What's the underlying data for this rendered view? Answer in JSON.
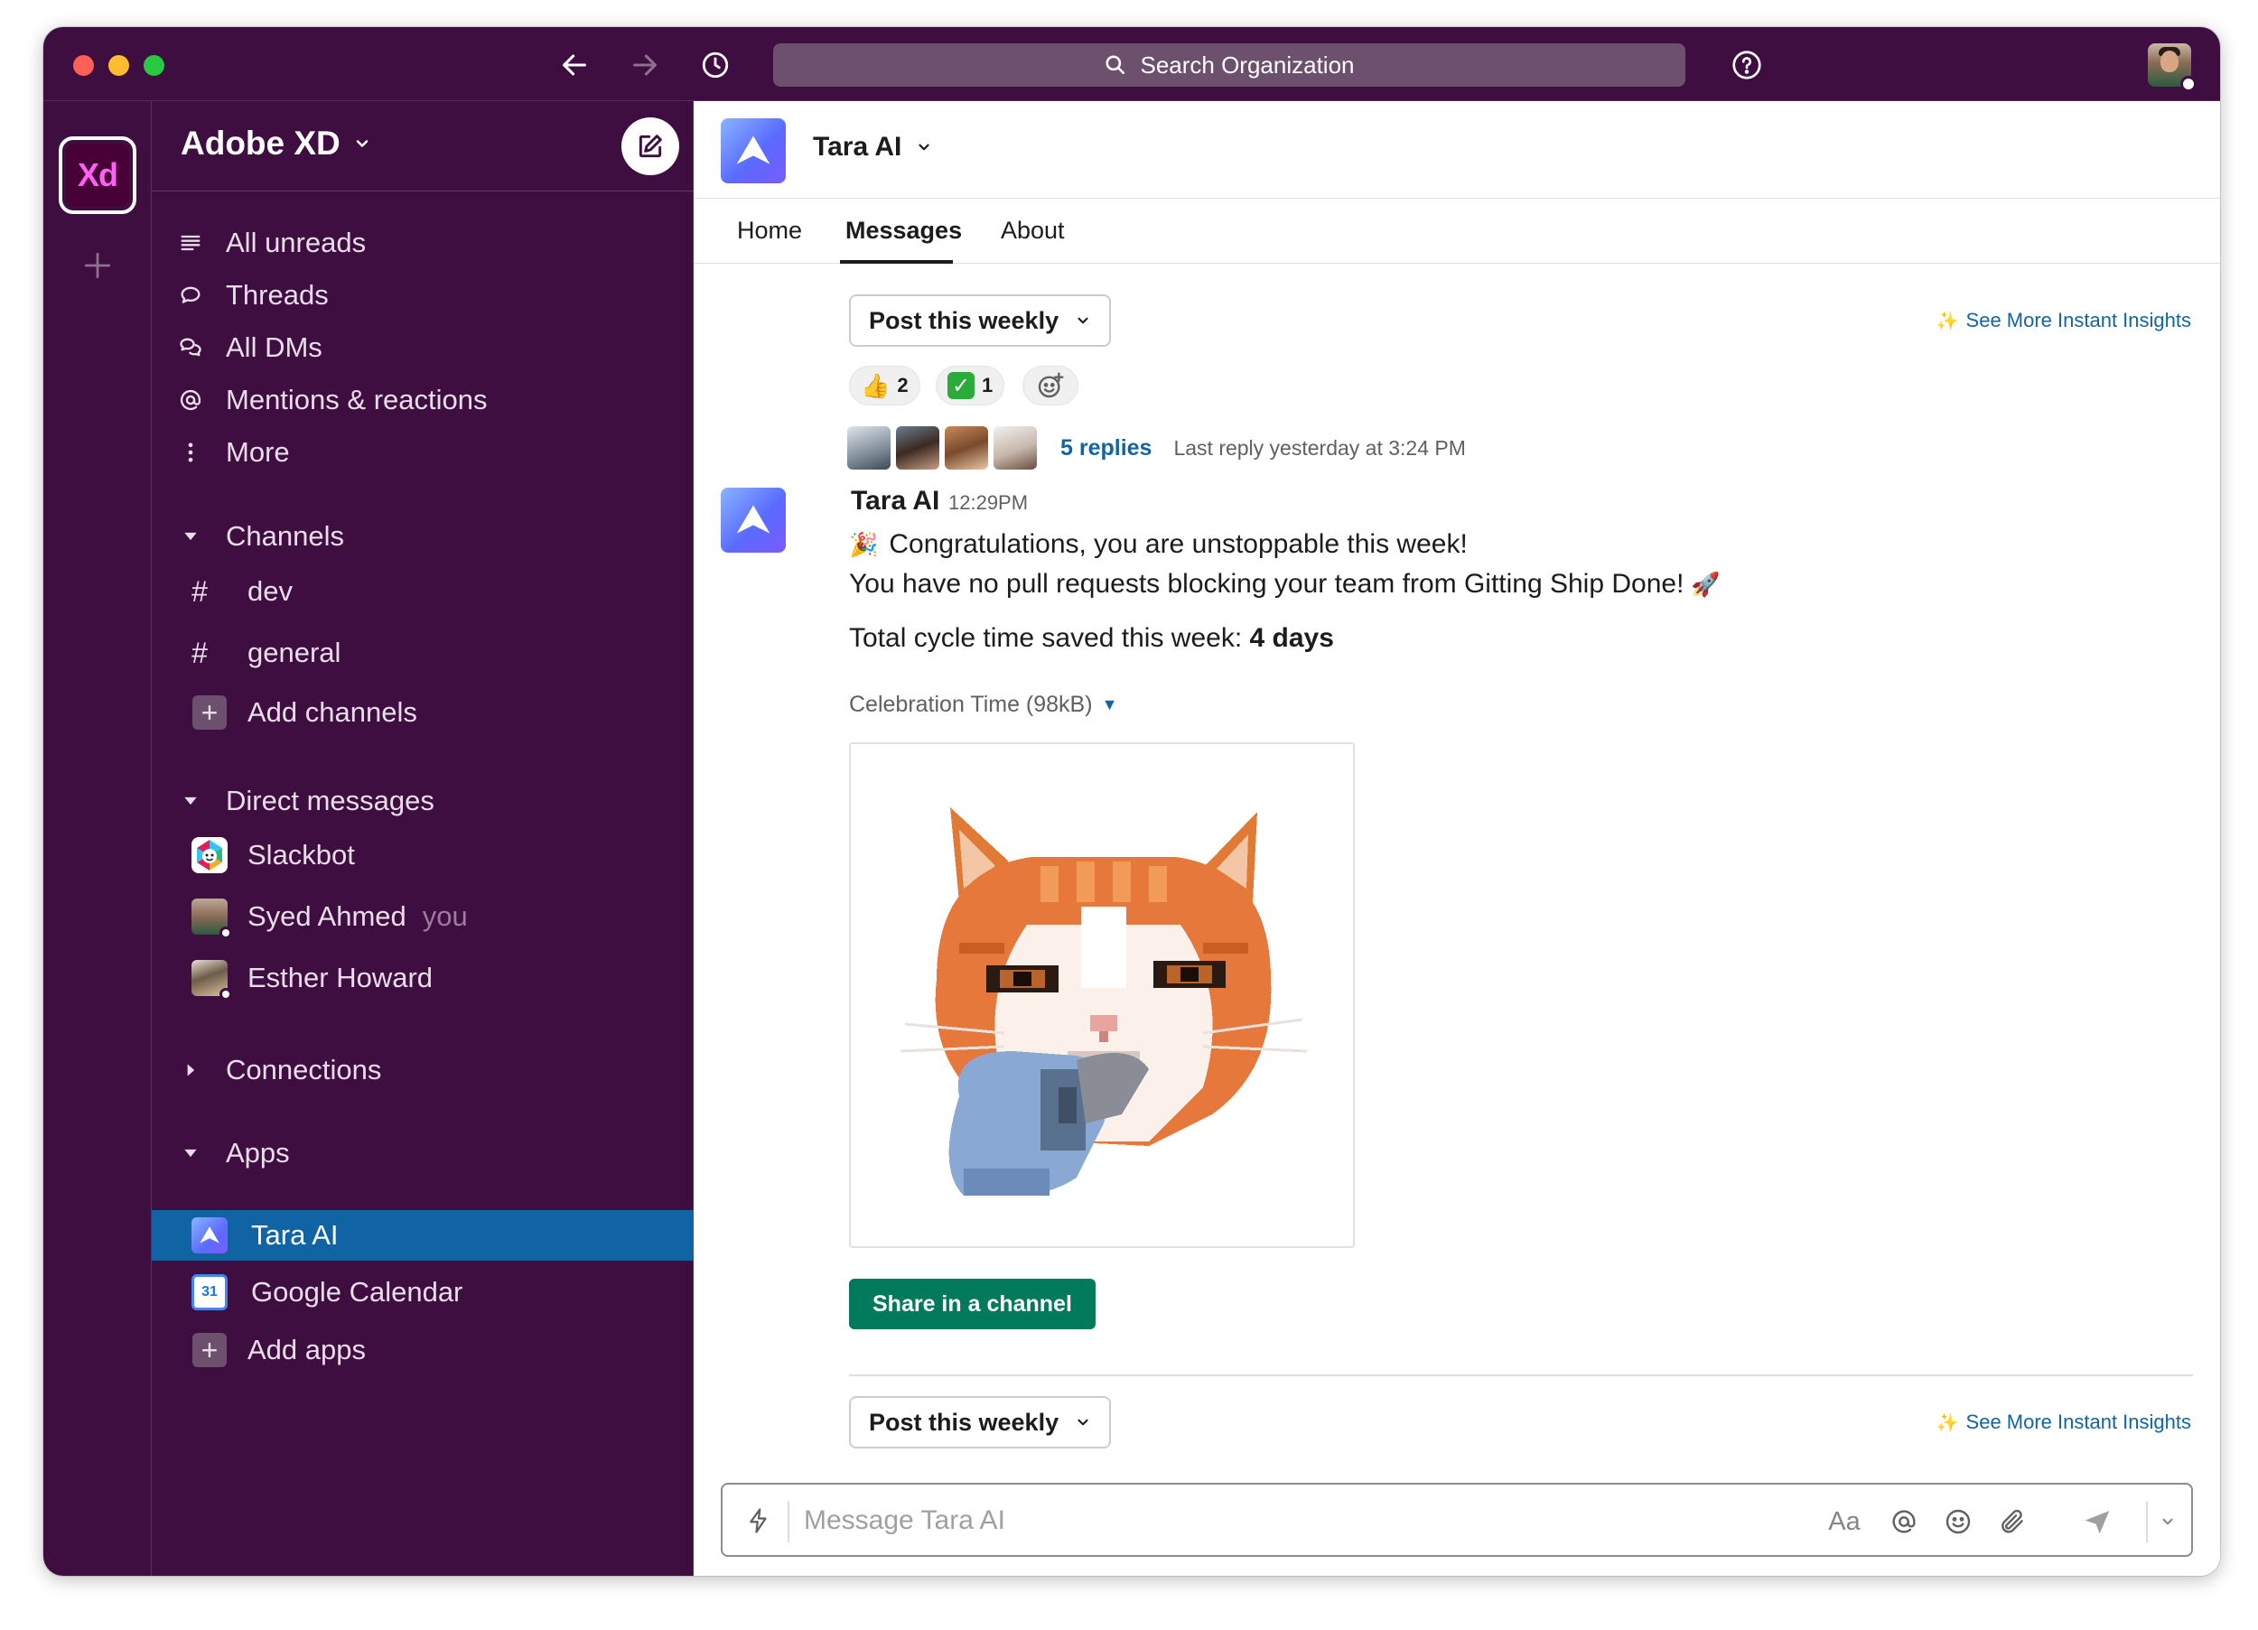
{
  "titlebar": {
    "search_placeholder": "Search Organization"
  },
  "rail": {
    "workspace_abbrev": "Xd"
  },
  "sidebar": {
    "workspace_name": "Adobe XD",
    "nav": [
      {
        "label": "All unreads",
        "icon": "all-unreads-icon"
      },
      {
        "label": "Threads",
        "icon": "threads-icon"
      },
      {
        "label": "All DMs",
        "icon": "dms-icon"
      },
      {
        "label": "Mentions & reactions",
        "icon": "at-icon"
      },
      {
        "label": "More",
        "icon": "more-vertical-icon"
      }
    ],
    "channels_header": "Channels",
    "channels": [
      {
        "name": "dev"
      },
      {
        "name": "general"
      }
    ],
    "add_channels": "Add channels",
    "dms_header": "Direct messages",
    "dms": [
      {
        "name": "Slackbot"
      },
      {
        "name": "Syed Ahmed",
        "suffix": "you"
      },
      {
        "name": "Esther Howard"
      }
    ],
    "connections_header": "Connections",
    "apps_header": "Apps",
    "apps": [
      {
        "name": "Tara AI",
        "active": true
      },
      {
        "name": "Google Calendar",
        "calendar_day": "31"
      }
    ],
    "add_apps": "Add apps"
  },
  "channel": {
    "name": "Tara AI",
    "tabs": [
      "Home",
      "Messages",
      "About"
    ],
    "active_tab": "Messages"
  },
  "messages": {
    "post_button": "Post this weekly",
    "insights_link": "See More Instant Insights",
    "reactions": [
      {
        "emoji": "👍",
        "count": "2"
      },
      {
        "emoji": "✓",
        "count": "1"
      }
    ],
    "thread": {
      "replies": "5 replies",
      "last_reply": "Last reply yesterday at 3:24 PM"
    },
    "message": {
      "author": "Tara AI",
      "time": "12:29PM",
      "line1": "Congratulations, you are unstoppable this week!",
      "line1_emoji": "🎉",
      "line2": "You have no pull requests blocking your team from Gitting Ship Done!",
      "line2_emoji": "🚀",
      "line3_prefix": "Total cycle time saved this week: ",
      "line3_value": "4 days",
      "attachment_title": "Celebration Time (98kB)",
      "share_button": "Share in a channel"
    }
  },
  "composer": {
    "placeholder": "Message Tara AI",
    "format_label": "Aa"
  }
}
